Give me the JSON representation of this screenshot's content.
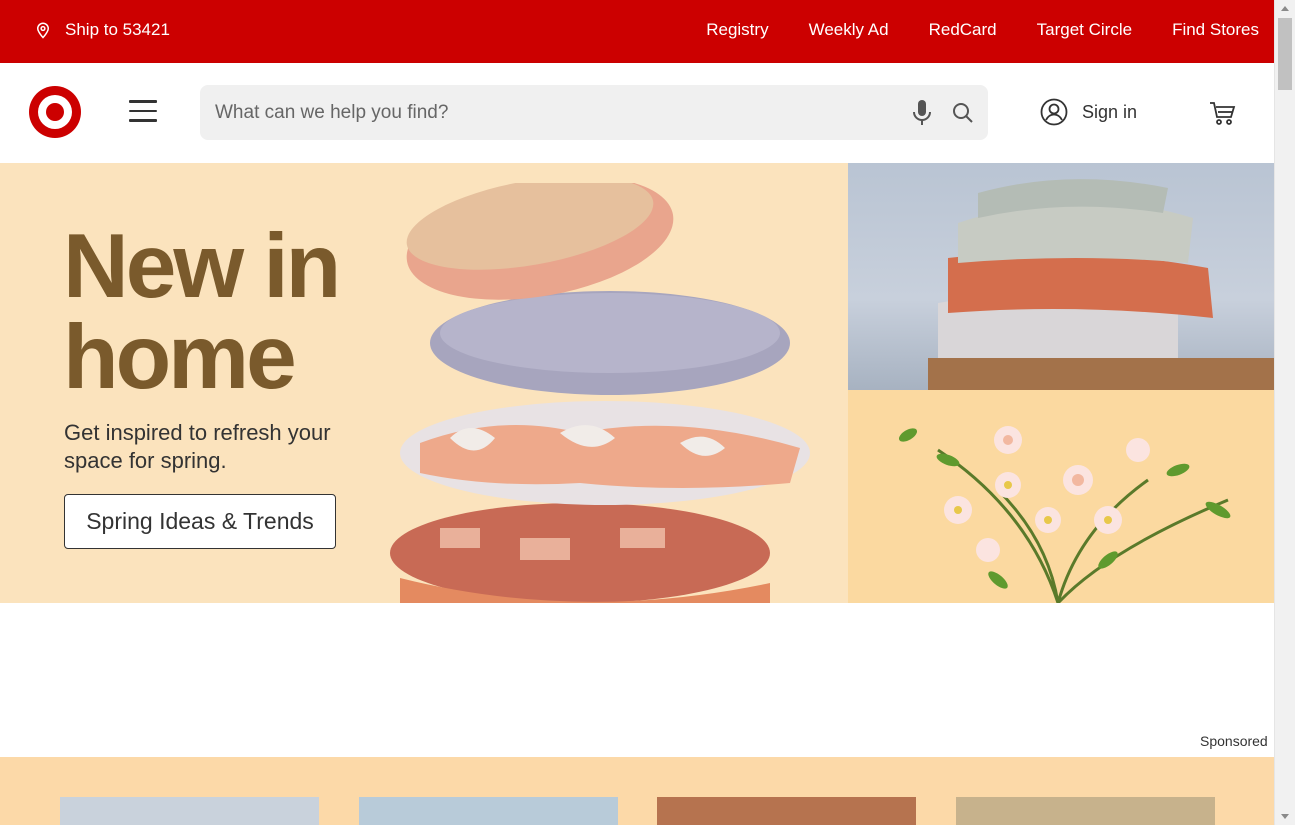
{
  "topbar": {
    "ship_to": "Ship to 53421",
    "links": [
      "Registry",
      "Weekly Ad",
      "RedCard",
      "Target Circle",
      "Find Stores"
    ]
  },
  "header": {
    "search_placeholder": "What can we help you find?",
    "sign_in": "Sign in"
  },
  "hero": {
    "title": "New in\nhome",
    "subtitle": "Get inspired to refresh your space for spring.",
    "button": "Spring Ideas & Trends"
  },
  "sponsored": "Sponsored",
  "colors": {
    "brand_red": "#cc0000",
    "hero_bg": "#fbe3bd",
    "hero_title": "#7a5a2c",
    "promo_bg": "#fcd9a8"
  }
}
